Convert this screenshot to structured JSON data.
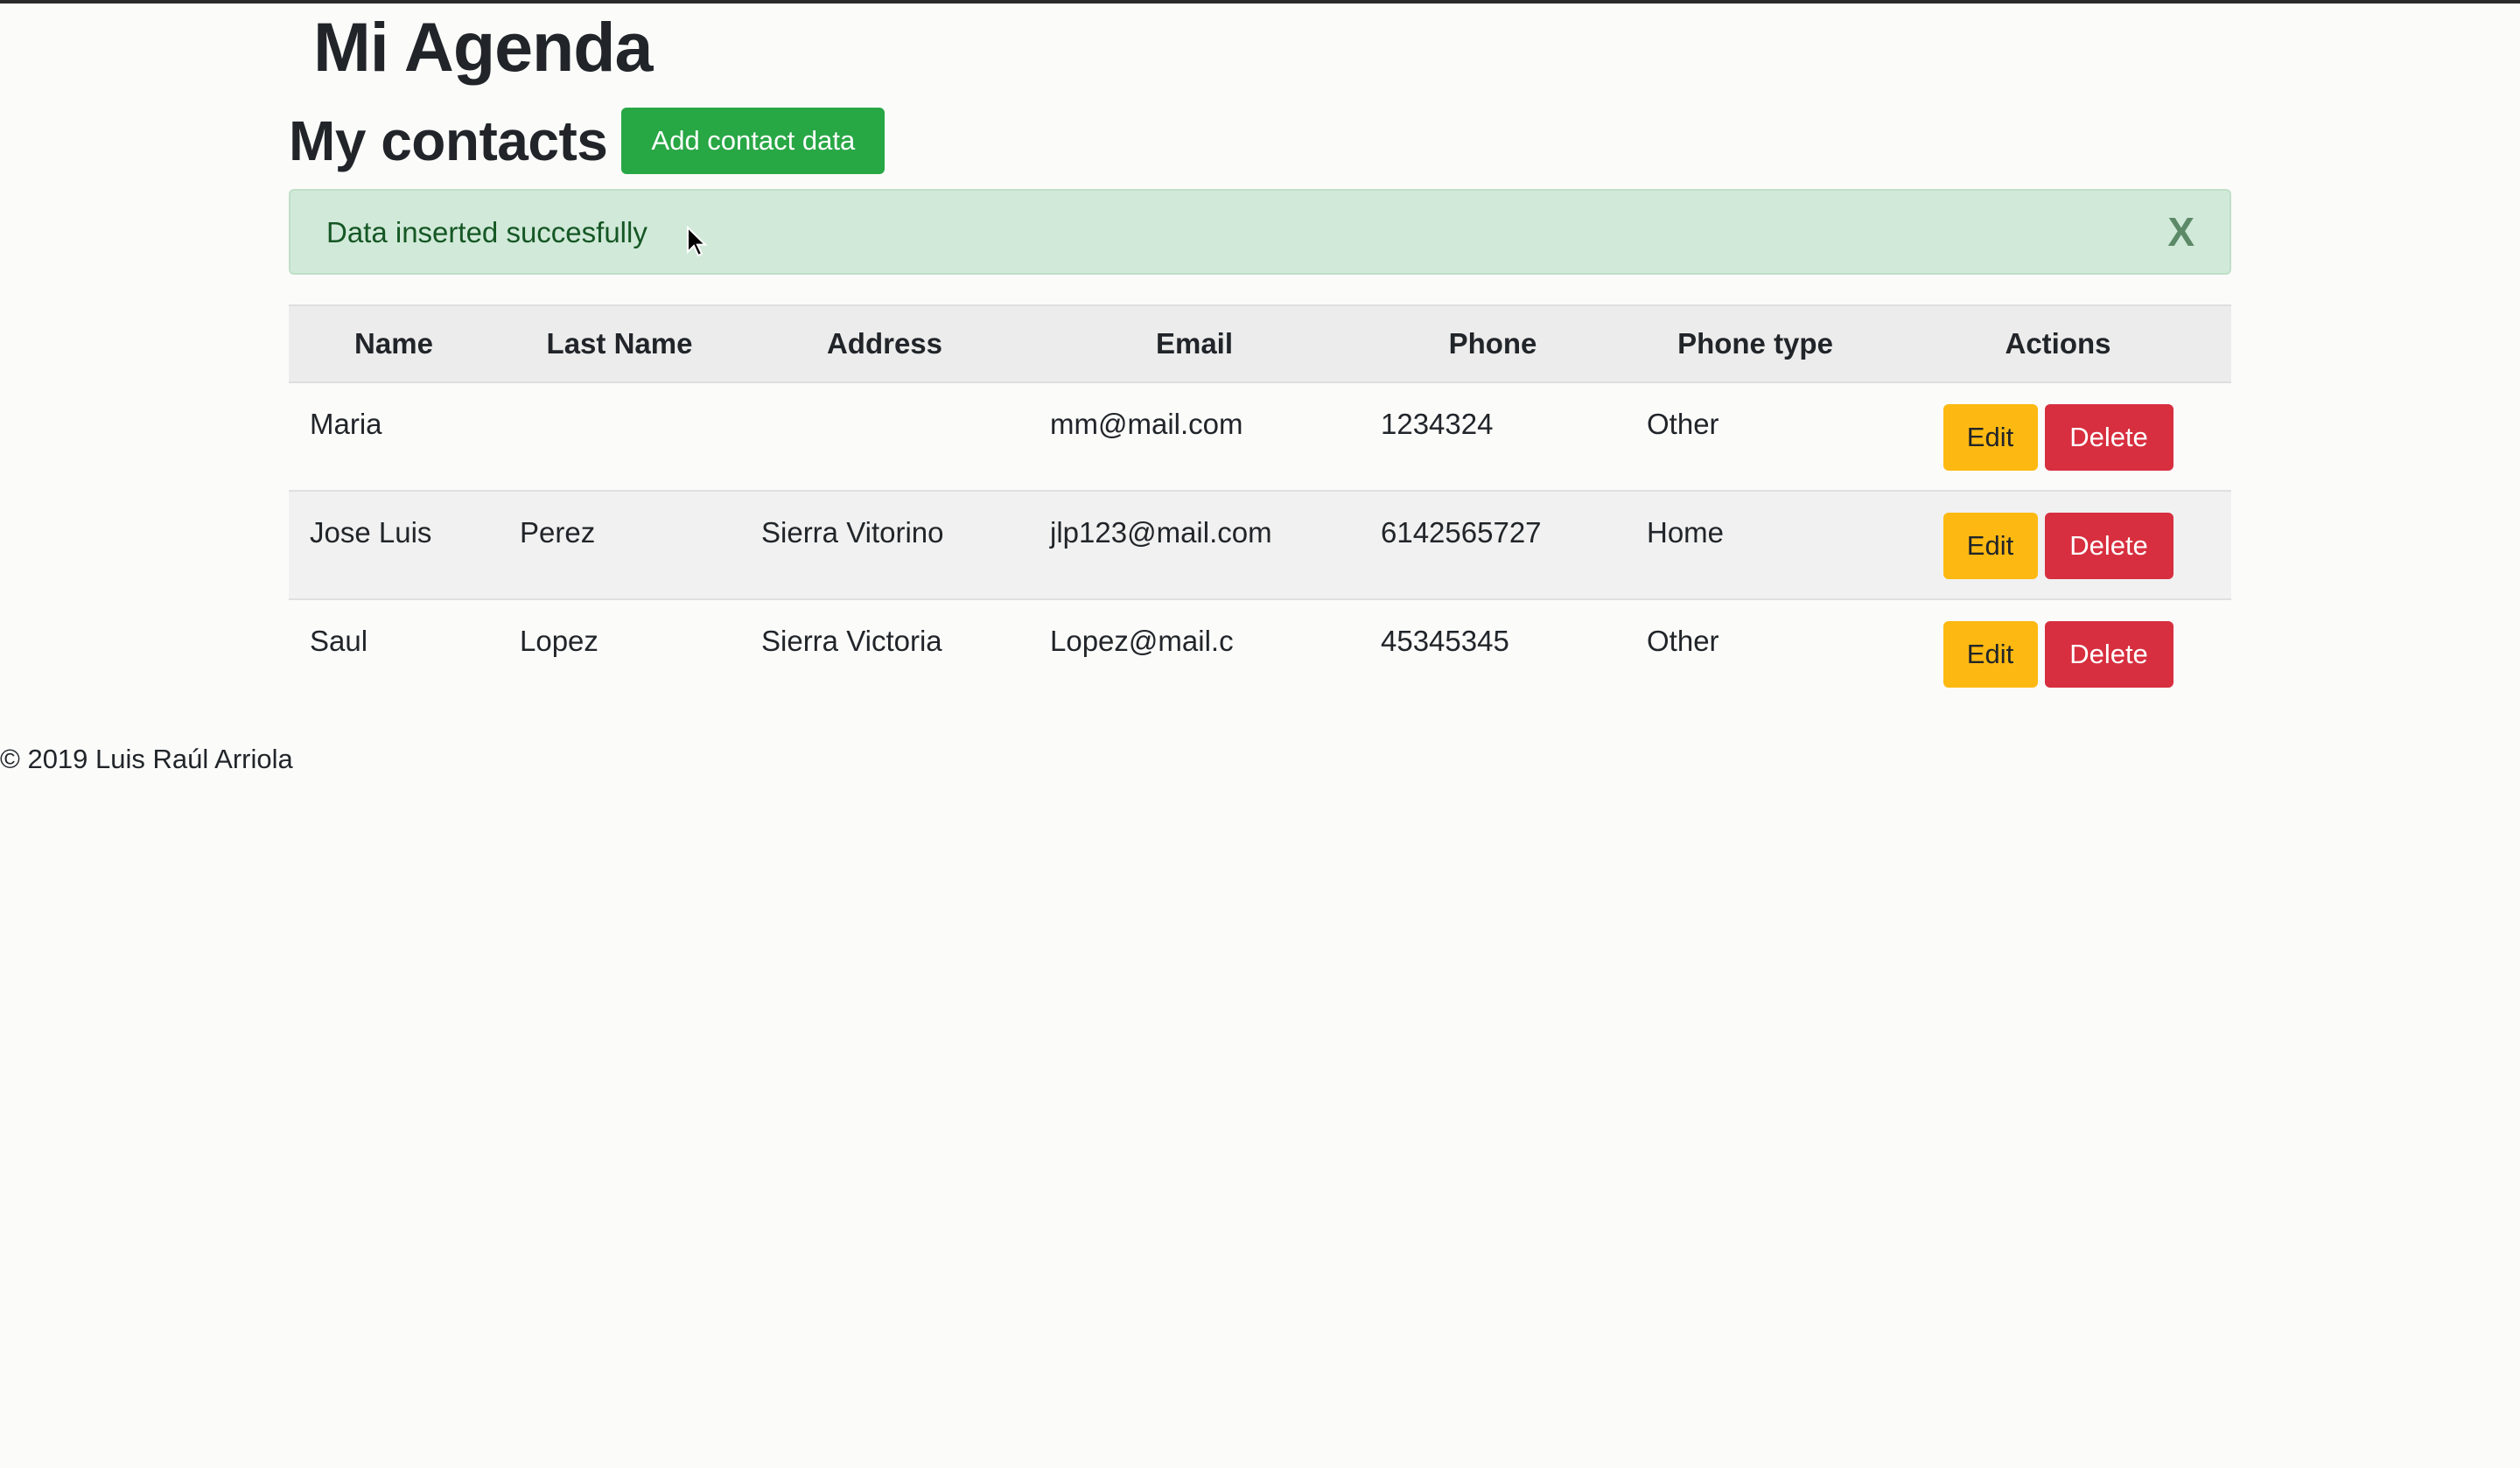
{
  "app": {
    "title": "Mi Agenda"
  },
  "contacts_page": {
    "heading": "My contacts",
    "add_button_label": "Add contact data"
  },
  "alert": {
    "message": "Data inserted succesfully",
    "close_label": "X"
  },
  "table": {
    "headers": [
      "Name",
      "Last Name",
      "Address",
      "Email",
      "Phone",
      "Phone type",
      "Actions"
    ],
    "rows": [
      {
        "name": "Maria",
        "last_name": "",
        "address": "",
        "email": "mm@mail.com",
        "phone": "1234324",
        "phone_type": "Other",
        "edit_label": "Edit",
        "delete_label": "Delete"
      },
      {
        "name": "Jose Luis",
        "last_name": "Perez",
        "address": "Sierra Vitorino",
        "email": "jlp123@mail.com",
        "phone": "6142565727",
        "phone_type": "Home",
        "edit_label": "Edit",
        "delete_label": "Delete"
      },
      {
        "name": "Saul",
        "last_name": "Lopez",
        "address": "Sierra Victoria",
        "email": "Lopez@mail.c",
        "phone": "45345345",
        "phone_type": "Other",
        "edit_label": "Edit",
        "delete_label": "Delete"
      }
    ]
  },
  "footer": {
    "text": "© 2019 Luis Raúl Arriola"
  },
  "colors": {
    "add_button": "#28a745",
    "edit_button": "#fdb912",
    "delete_button": "#d72f3f",
    "alert_background": "#d1e9d9",
    "alert_text": "#155724"
  },
  "icons": {
    "cursor": "mouse-pointer-icon"
  }
}
